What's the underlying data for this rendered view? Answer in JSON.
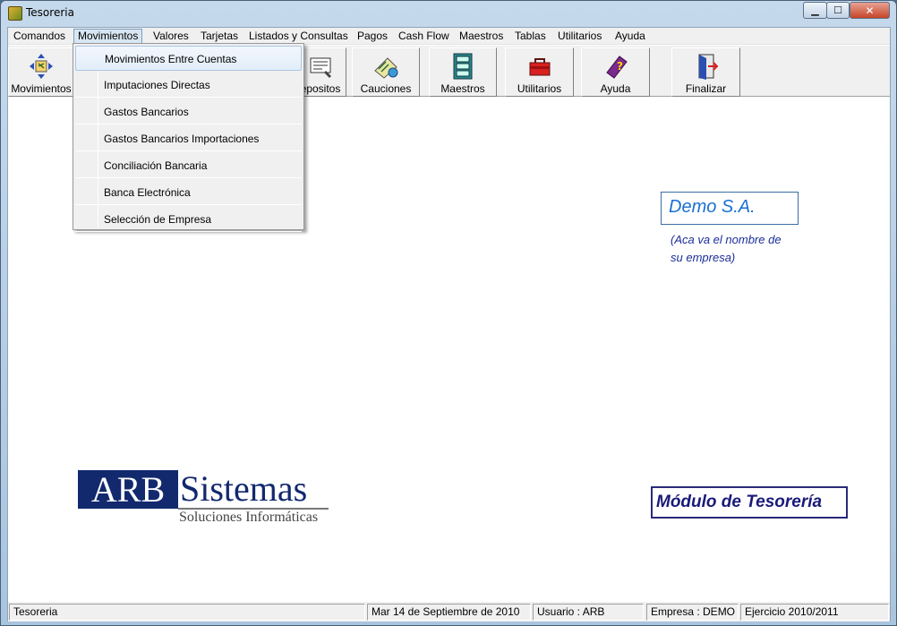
{
  "window": {
    "title": "Tesoreria"
  },
  "menubar": [
    "Comandos",
    "Movimientos",
    "Valores",
    "Tarjetas",
    "Listados y Consultas",
    "Pagos",
    "Cash Flow",
    "Maestros",
    "Tablas",
    "Utilitarios",
    "Ayuda"
  ],
  "toolbar": [
    {
      "label": "Movimientos",
      "icon": "arrows-icon"
    },
    {
      "label": "epositos",
      "icon": "deposit-icon"
    },
    {
      "label": "Cauciones",
      "icon": "cauciones-icon"
    },
    {
      "label": "Maestros",
      "icon": "cabinet-icon"
    },
    {
      "label": "Utilitarios",
      "icon": "toolbox-icon"
    },
    {
      "label": "Ayuda",
      "icon": "help-book-icon"
    },
    {
      "label": "Finalizar",
      "icon": "exit-door-icon"
    }
  ],
  "dropdown": [
    "Movimientos Entre Cuentas",
    "Imputaciones Directas",
    "Gastos Bancarios",
    "Gastos Bancarios Importaciones",
    "Conciliación Bancaria",
    "Banca Electrónica",
    "Selección de Empresa"
  ],
  "empresa": {
    "name": "Demo S.A.",
    "hint_line1": "(Aca va el nombre de",
    "hint_line2": "su empresa)"
  },
  "logo": {
    "arb": "ARB",
    "sistemas": "Sistemas",
    "sub": "Soluciones Informáticas"
  },
  "modulo": "Módulo de Tesorería",
  "status": {
    "app": "Tesoreria",
    "date": "Mar 14 de Septiembre de 2010",
    "user": "Usuario : ARB",
    "company": "Empresa : DEMO",
    "exercise": "Ejercicio 2010/2011"
  }
}
